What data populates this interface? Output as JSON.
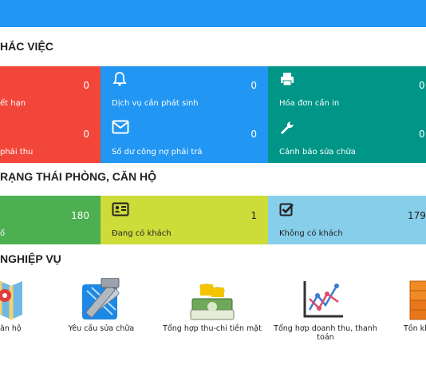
{
  "sections": {
    "work_reminders": "HẮC VIỆC",
    "room_status": "RẠNG THÁI PHÒNG, CĂN HỘ",
    "operations": "NGHIỆP VỤ"
  },
  "reminder_tiles": [
    {
      "label": "ết hạn",
      "count": "0",
      "color": "#f2463a"
    },
    {
      "label": "Dịch vụ cần phát sinh",
      "count": "0",
      "icon": "bell-icon",
      "color": "#2196f3"
    },
    {
      "label": "Hóa đơn cần in",
      "count": "0",
      "icon": "printer-icon",
      "color": "#009687"
    },
    {
      "label": "phải thu",
      "count": "0",
      "color": "#f2463a"
    },
    {
      "label": "Số dư công nợ phải trả",
      "count": "0",
      "icon": "envelope-icon",
      "color": "#2196f3"
    },
    {
      "label": "Cảnh báo sửa chữa",
      "count": "0",
      "icon": "wrench-icon",
      "color": "#009687"
    }
  ],
  "status_tiles": [
    {
      "label": "ố",
      "count": "180",
      "color": "#4caf50"
    },
    {
      "label": "Đang có khách",
      "count": "1",
      "icon": "id-card-icon",
      "color": "#cddc39"
    },
    {
      "label": "Không có khách",
      "count": "179",
      "icon": "checkbox-icon",
      "color": "#87ceeb"
    }
  ],
  "apps": [
    {
      "label": "ăn hộ",
      "icon": "map-icon"
    },
    {
      "label": "Yêu cầu sửa chữa",
      "icon": "hammer-ruler-icon"
    },
    {
      "label": "Tổng hợp thu-chi tiền mặt",
      "icon": "cash-stack-icon"
    },
    {
      "label": "Tổng hợp doanh thu, thanh toán",
      "icon": "line-chart-icon"
    },
    {
      "label": "Tồn kh",
      "icon": "boxes-icon"
    }
  ]
}
